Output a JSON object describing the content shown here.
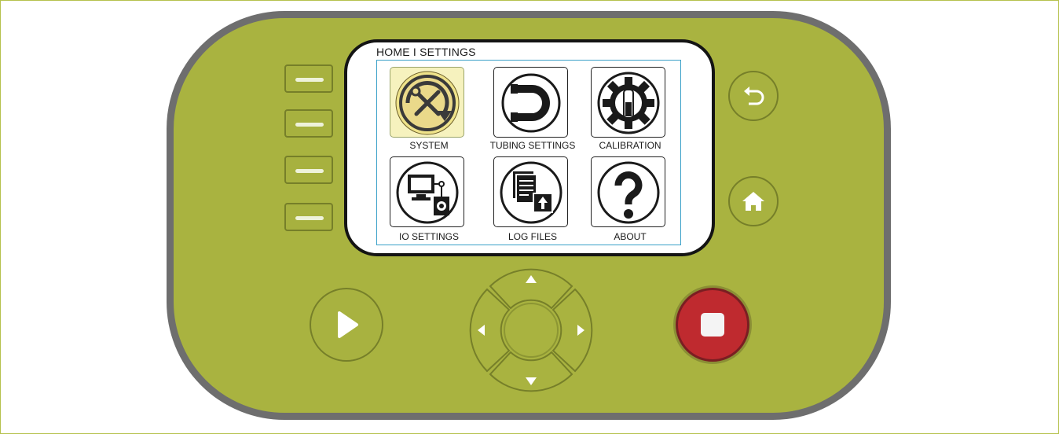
{
  "screen": {
    "breadcrumb": "HOME I SETTINGS",
    "tiles": [
      {
        "label": "SYSTEM",
        "icon": "system-tools-icon",
        "selected": true
      },
      {
        "label": "TUBING SETTINGS",
        "icon": "tubing-icon",
        "selected": false
      },
      {
        "label": "CALIBRATION",
        "icon": "calibration-gear-icon",
        "selected": false
      },
      {
        "label": "IO SETTINGS",
        "icon": "io-computer-icon",
        "selected": false
      },
      {
        "label": "LOG FILES",
        "icon": "log-files-icon",
        "selected": false
      },
      {
        "label": "ABOUT",
        "icon": "question-mark-icon",
        "selected": false
      }
    ]
  },
  "hardware_buttons": {
    "softkeys": 4,
    "back_icon": "back-arrow-icon",
    "home_icon": "home-icon",
    "play_icon": "play-icon",
    "stop_icon": "stop-icon",
    "dpad_icons": [
      "arrow-up-icon",
      "arrow-down-icon",
      "arrow-left-icon",
      "arrow-right-icon"
    ]
  },
  "colors": {
    "device_body": "#a9b340",
    "device_border": "#6e6e6e",
    "stop_button": "#bf2a2f",
    "selected_tile": "#f6f2be",
    "panel_border": "#3aa0c8"
  }
}
